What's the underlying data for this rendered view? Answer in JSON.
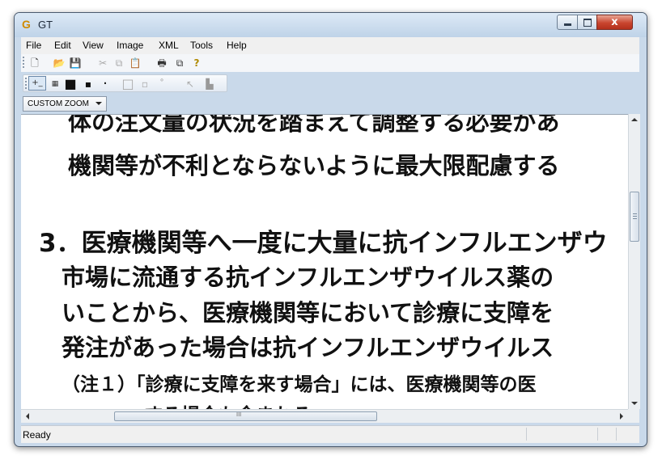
{
  "window": {
    "title": "GT",
    "app_icon_letter": "G",
    "close_glyph": "x"
  },
  "menu": [
    "File",
    "Edit",
    "View",
    "Image",
    "XML",
    "Tools",
    "Help"
  ],
  "toolbar_main": {
    "icons": [
      "new-file-icon",
      "open-folder-icon",
      "save-icon",
      "cut-icon",
      "copy-icon",
      "paste-icon",
      "print-icon",
      "copy-page-icon",
      "help-icon"
    ],
    "glyphs": [
      "🗋",
      "📂",
      "💾",
      "✂",
      "⧉",
      "📋",
      "🖶",
      "⧉",
      "?"
    ]
  },
  "toolbar_tools": {
    "icons": [
      "add-region-icon",
      "select-icon",
      "rectangle-large-icon",
      "rectangle-small-icon",
      "dot-icon",
      "square-outline-icon",
      "square-small-icon",
      "small-arrow-icon",
      "pointer-icon",
      "crop-icon"
    ],
    "glyphs": [
      "+_",
      "▦",
      "■",
      "▪",
      "·",
      "□",
      "▫",
      "˚",
      "↖",
      "▙"
    ]
  },
  "zoom": {
    "label": "CUSTOM ZOOM"
  },
  "document": {
    "lines": [
      "体の注文量の状況を踏まえて調整する必要があ",
      "機関等が不利とならないように最大限配慮する",
      "3．医療機関等へ一度に大量に抗インフルエンザウ",
      "市場に流通する抗インフルエンザウイルス薬の",
      "いことから、医療機関等において診療に支障を",
      "発注があった場合は抗インフルエンザウイルス",
      "（注１）「診療に支障を来す場合」には、医療機関等の医",
      "する場合も含まれる。"
    ]
  },
  "hscroll_grip": "III",
  "status": {
    "text": "Ready"
  },
  "colors": {
    "titlebar": "#c9d9ea",
    "close": "#c9452f"
  }
}
